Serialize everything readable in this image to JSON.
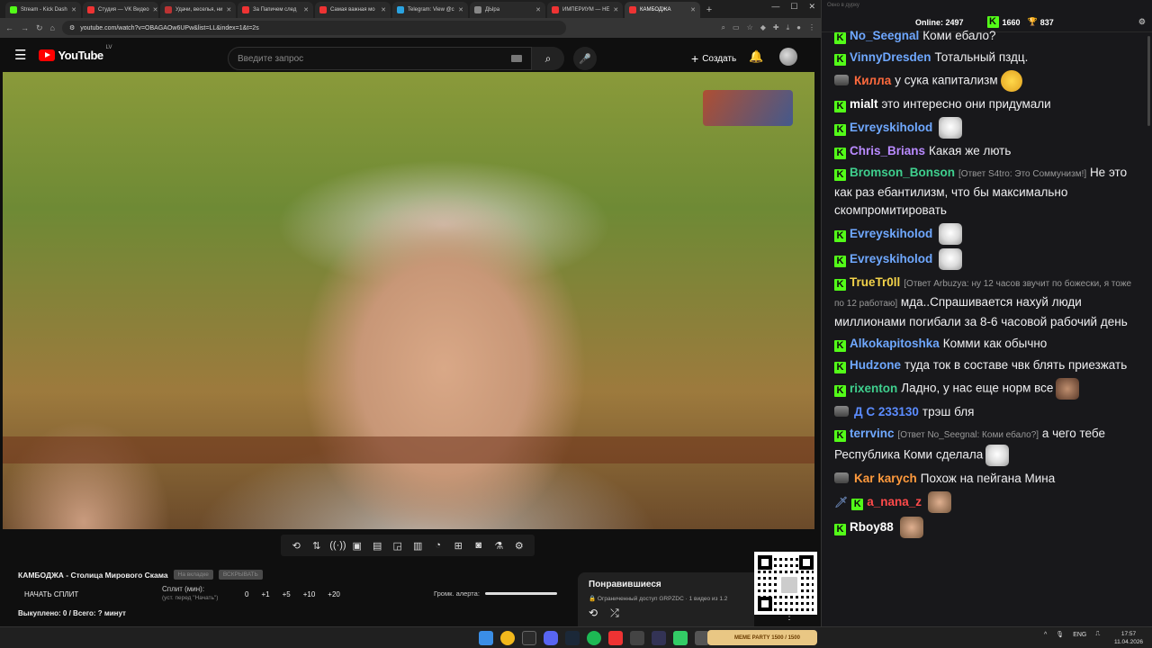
{
  "browser": {
    "tabs": [
      {
        "label": "Stream - Kick Dash",
        "color": "#53fc18"
      },
      {
        "label": "Студия — VK Видео",
        "color": "#e33"
      },
      {
        "label": "Удачи, веселья, ни",
        "color": "#b33"
      },
      {
        "label": "За Папичем след",
        "color": "#e33"
      },
      {
        "label": "Самая важная мо",
        "color": "#e33"
      },
      {
        "label": "Telegram: View @c",
        "color": "#2aa3e0"
      },
      {
        "label": "ДЫра",
        "color": "#888"
      },
      {
        "label": "ИМПЕРИУМ — НЕ",
        "color": "#e33"
      },
      {
        "label": "КАМБОДЖА",
        "color": "#e33"
      }
    ],
    "new_tab": "+",
    "url": "youtube.com/watch?v=OBAGAOw6UPw&list=LL&index=1&t=2s"
  },
  "youtube": {
    "logo_text": "YouTube",
    "region": "LV",
    "search_placeholder": "Введите запрос",
    "create_label": "Создать"
  },
  "player": {
    "title": "КАМБОДЖА - Столица Мирового Скама",
    "chip1": "На вкладке",
    "chip2": "ВСКРЫВАТЬ",
    "split_button": "НАЧАТЬ СПЛИТ",
    "split_label": "Сплит (мин):",
    "split_sub": "(уст. перед \"Начать\")",
    "split_values": [
      "0",
      "+1",
      "+5",
      "+10",
      "+20"
    ],
    "alert_label": "Громк. алерта:",
    "bought": "Выкуплено: 0 / Всего: ? минут"
  },
  "liked": {
    "title": "Понравившиеся",
    "sub": "Ограниченный доступ  GRPZDC · 1 видео из 1.2"
  },
  "chat": {
    "header": "Окно в дурку",
    "online": "Online: 2497",
    "k_count": "1660",
    "c_count": "837",
    "messages": [
      {
        "user": "No_Seegnal",
        "color": "#6fa8ff",
        "badge": "k",
        "text": "Коми ебало?"
      },
      {
        "user": "VinnyDresden",
        "color": "#6fa8ff",
        "badge": "k",
        "text": "Тотальный пздц."
      },
      {
        "user": "Килла",
        "color": "#ff6a3d",
        "badge": "s",
        "text": "у сука капитализм",
        "emote": "grin"
      },
      {
        "user": "mialt",
        "color": "#ffffff",
        "badge": "k",
        "text": "это интересно они придумали"
      },
      {
        "user": "Evreyskiholod",
        "color": "#6fa8ff",
        "badge": "k",
        "text": "",
        "emote": "cat"
      },
      {
        "user": "Chris_Brians",
        "color": "#b98aff",
        "badge": "k",
        "text": "Какая же лють"
      },
      {
        "user": "Bromson_Bonson",
        "color": "#3fcf8e",
        "badge": "k",
        "reply": "[Ответ S4tro: Это Соммунизм!]",
        "text": "Не это как раз ебантилизм, что бы максимально скомпромитировать"
      },
      {
        "user": "Evreyskiholod",
        "color": "#6fa8ff",
        "badge": "k",
        "text": "",
        "emote": "cat"
      },
      {
        "user": "Evreyskiholod",
        "color": "#6fa8ff",
        "badge": "k",
        "text": "",
        "emote": "cat"
      },
      {
        "user": "TrueTr0ll",
        "color": "#f3d34a",
        "badge": "k",
        "reply": "[Ответ Arbuzya: ну 12 часов звучит по божески, я тоже по 12 работаю]",
        "text": "мда..Спрашивается нахуй люди миллионами погибали за 8-6 часовой рабочий день"
      },
      {
        "user": "Alkokapitoshka",
        "color": "#6fa8ff",
        "badge": "k",
        "text": "Комми как обычно"
      },
      {
        "user": "Hudzone",
        "color": "#6fa8ff",
        "badge": "k",
        "text": "туда ток в составе чвк блять приезжать"
      },
      {
        "user": "rixenton",
        "color": "#3fcf8e",
        "badge": "k",
        "text": "Ладно, у нас еще норм все",
        "emote": "face"
      },
      {
        "user": "Д С 233130",
        "color": "#5b8cff",
        "badge": "s",
        "text": "трэш бля"
      },
      {
        "user": "terrvinc",
        "color": "#6fa8ff",
        "badge": "k",
        "reply": "[Ответ No_Seegnal: Коми ебало?]",
        "text": "а чего тебе Республика Коми сделала",
        "emote": "cat"
      },
      {
        "user": "Kar karych",
        "color": "#ff9a3d",
        "badge": "s",
        "text": "Похож на пейгана Мина"
      },
      {
        "user": "a_nana_z",
        "color": "#ff4a4a",
        "badge": "sk",
        "text": "",
        "emote": "face2"
      },
      {
        "user": "Rboy88",
        "color": "#ffffff",
        "badge": "k",
        "text": "",
        "emote": "face2"
      }
    ]
  },
  "taskbar": {
    "meme_label": "MEME PARTY",
    "meme_score": "1500 / 1500",
    "lang": "ENG",
    "time": "17:57",
    "date": "11.04.2026"
  }
}
